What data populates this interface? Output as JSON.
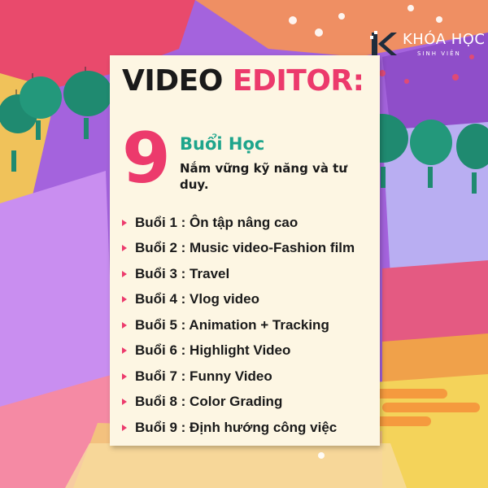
{
  "logo": {
    "title": "KHÓA HỌC",
    "subtitle": "SINH VIÊN"
  },
  "title": {
    "part1": "VIDEO",
    "part2": "EDITOR",
    "colon": ":"
  },
  "highlight": {
    "number": "9",
    "sessions": "Buổi Học",
    "subtitle": "Nắm vững kỹ năng và tư duy."
  },
  "sessions": [
    "Buổi 1 : Ôn tập nâng cao",
    "Buổi 2 : Music video-Fashion film",
    "Buổi 3 : Travel",
    "Buổi 4 : Vlog video",
    "Buổi 5 : Animation + Tracking",
    "Buổi 6 : Highlight Video",
    "Buổi 7 : Funny Video",
    "Buổi 8 : Color Grading",
    "Buổi 9 : Định hướng công việc"
  ],
  "colors": {
    "accent": "#ec3a6c",
    "teal": "#1ea58c",
    "card": "#fdf6e3",
    "background": "#9c5bd6"
  }
}
